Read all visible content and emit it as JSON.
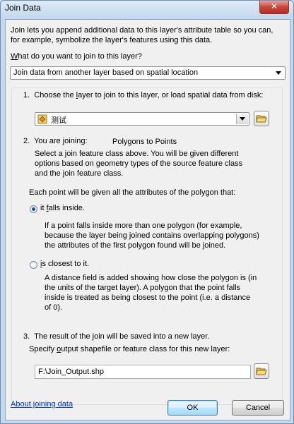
{
  "window": {
    "title": "Join Data",
    "close_glyph": "✕"
  },
  "intro": {
    "line1": "Join lets you append additional data to this layer's attribute table so you can,",
    "line2": "for example, symbolize the layer's features using this data."
  },
  "join_type": {
    "label_prefix": "W",
    "label_rest": "hat do you want to join to this layer?",
    "selected": "Join data from another layer based on spatial location"
  },
  "step1": {
    "number": "1.",
    "label_a": "Choose the ",
    "label_u": "l",
    "label_b": "ayer to join to this layer, or load spatial data from disk:",
    "layer_value": "测试",
    "layer_icon": "polygon-layer-icon"
  },
  "step2": {
    "number": "2.",
    "label": "You are joining:",
    "joining_value": "Polygons to Points",
    "desc1": "Select a join feature class above.  You will be given different",
    "desc2": "options based on geometry types of the source feature class",
    "desc3": "and the join feature class.",
    "each_point": "Each point will be given all the attributes of the polygon that:",
    "opt1_u": "it ",
    "opt1_f": "f",
    "opt1_rest": "alls inside.",
    "opt1_d1": "If a point falls inside more than one polygon (for example,",
    "opt1_d2": "because the layer being joined contains overlapping polygons)",
    "opt1_d3": "the attributes of the first polygon found will be joined.",
    "opt2_i": "i",
    "opt2_rest": "s closest to it.",
    "opt2_d1": "A distance field is added showing how close the polygon is (in",
    "opt2_d2": "the units of the target layer).  A polygon that the point falls",
    "opt2_d3": "inside is treated as being closest to the point (i.e. a distance",
    "opt2_d4": "of 0)."
  },
  "step3": {
    "number": "3.",
    "label": "The result of the join will be saved into a new layer.",
    "specify_a": "Specify ",
    "specify_u": "o",
    "specify_b": "utput shapefile or feature class for this new layer:",
    "output_path": "F:\\Join_Output.shp"
  },
  "footer": {
    "about_link": "About joining data",
    "ok": "OK",
    "cancel": "Cancel"
  }
}
